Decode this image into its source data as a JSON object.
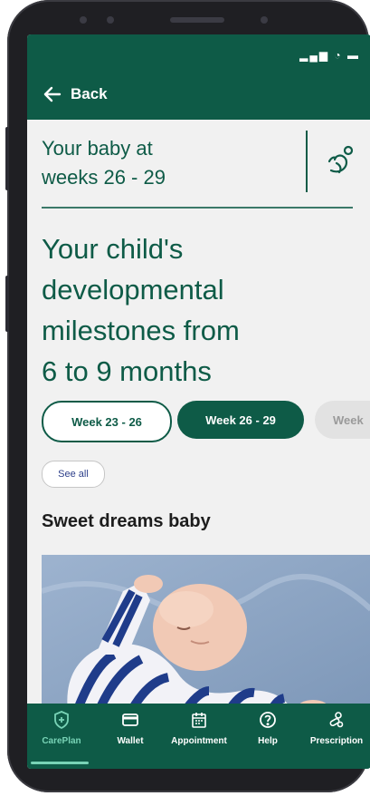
{
  "header": {
    "back_label": "Back"
  },
  "week_header": {
    "title_line1": "Your baby at",
    "title_line2": "weeks 26 - 29"
  },
  "main": {
    "title_lines": [
      "Your child's",
      "developmental",
      "milestones from",
      "6 to 9 months"
    ],
    "chips": [
      {
        "label": "Week 23 - 26",
        "state": "outline"
      },
      {
        "label": "Week 26 - 29",
        "state": "selected"
      },
      {
        "label": "Week",
        "state": "muted"
      }
    ],
    "see_all_label": "See all",
    "section_title": "Sweet dreams baby"
  },
  "bottom_nav": {
    "items": [
      {
        "label": "CarePlan",
        "icon": "careplan-shield-icon",
        "active": true
      },
      {
        "label": "Wallet",
        "icon": "wallet-card-icon",
        "active": false
      },
      {
        "label": "Appointment",
        "icon": "calendar-icon",
        "active": false
      },
      {
        "label": "Help",
        "icon": "help-question-icon",
        "active": false
      },
      {
        "label": "Prescription",
        "icon": "pill-capsule-icon",
        "active": false
      }
    ]
  },
  "colors": {
    "brand": "#0e5b47",
    "active": "#78d3b6",
    "background": "#f1f1f1"
  }
}
